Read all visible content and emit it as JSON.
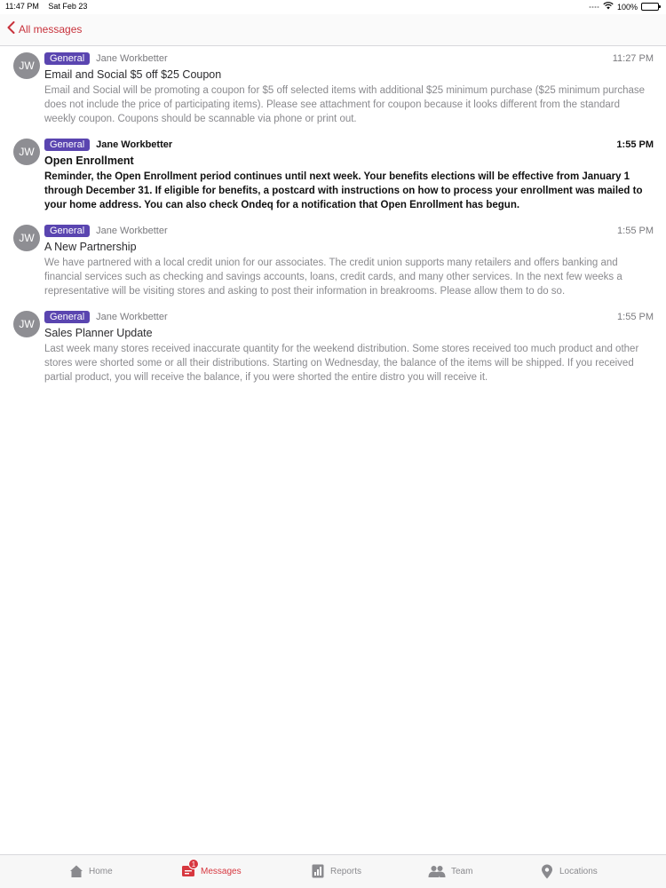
{
  "status_bar": {
    "time": "11:47 PM",
    "date": "Sat Feb 23",
    "battery": "100%",
    "battery_level": 1.0
  },
  "nav": {
    "back_label": "All messages"
  },
  "messages": [
    {
      "initials": "JW",
      "category": "General",
      "sender": "Jane Workbetter",
      "time": "11:27 PM",
      "subject": "Email and Social $5 off $25 Coupon",
      "preview": "Email and Social will be promoting a coupon for $5 off selected items with additional $25 minimum purchase ($25 minimum purchase does not include the price of participating items). Please see attachment for coupon because it looks different from the standard weekly coupon. Coupons should be scannable via phone or print out.",
      "unread": false
    },
    {
      "initials": "JW",
      "category": "General",
      "sender": "Jane Workbetter",
      "time": "1:55 PM",
      "subject": "Open Enrollment",
      "preview": "Reminder, the Open Enrollment period continues until next week. Your benefits elections will be effective from January 1 through December 31. If eligible for benefits, a postcard with instructions on how to process your enrollment was mailed to your home address. You can also check Ondeq for a notification that Open Enrollment has begun.",
      "unread": true
    },
    {
      "initials": "JW",
      "category": "General",
      "sender": "Jane Workbetter",
      "time": "1:55 PM",
      "subject": "A New Partnership",
      "preview": "We have partnered with a local credit union for our associates. The credit union supports many retailers and offers banking and financial services such as checking and savings accounts, loans, credit cards, and many other services. In the next few weeks a representative will be visiting stores and asking to post their information in breakrooms. Please allow them to do so.",
      "unread": false
    },
    {
      "initials": "JW",
      "category": "General",
      "sender": "Jane Workbetter",
      "time": "1:55 PM",
      "subject": "Sales Planner Update",
      "preview": "Last week many stores received inaccurate quantity for the weekend distribution. Some stores received too much product and other stores were shorted some or all their distributions. Starting on Wednesday, the balance of the items will be shipped. If you received partial product, you will receive the balance, if you were shorted the entire distro you will receive it.",
      "unread": false
    }
  ],
  "tabs": [
    {
      "label": "Home",
      "icon": "home-icon"
    },
    {
      "label": "Messages",
      "icon": "messages-icon",
      "badge": "1",
      "active": true
    },
    {
      "label": "Reports",
      "icon": "reports-icon"
    },
    {
      "label": "Team",
      "icon": "team-icon"
    },
    {
      "label": "Locations",
      "icon": "location-pin-icon"
    }
  ],
  "colors": {
    "accent": "#d7373f",
    "badge": "#5a45b0",
    "avatar": "#8e8e93"
  }
}
